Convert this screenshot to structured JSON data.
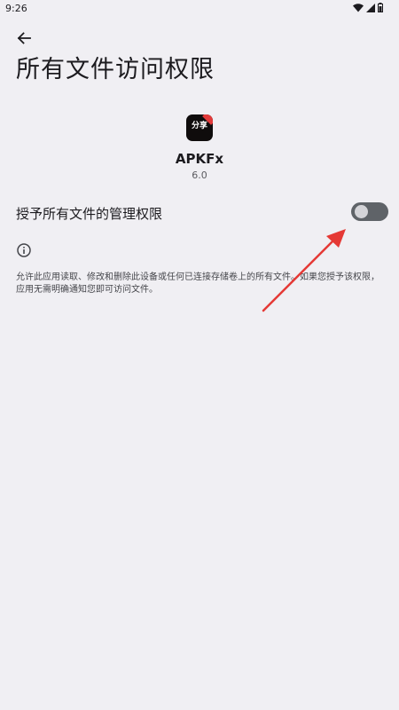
{
  "status_bar": {
    "time": "9:26",
    "icons": [
      "wifi-icon",
      "signal-icon",
      "battery-icon"
    ]
  },
  "header": {
    "back_icon": "arrow-back-icon",
    "title": "所有文件访问权限"
  },
  "app": {
    "icon_text": "分享",
    "name": "APKFx",
    "version": "6.0"
  },
  "setting": {
    "label": "授予所有文件的管理权限",
    "toggle_on": false
  },
  "info": {
    "icon": "info-icon",
    "description": "允许此应用读取、修改和删除此设备或任何已连接存储卷上的所有文件。如果您授予该权限，应用无需明确通知您即可访问文件。"
  },
  "colors": {
    "background": "#f0eff3",
    "toggle_track": "#5f6368",
    "annotation_arrow": "#e53935"
  }
}
